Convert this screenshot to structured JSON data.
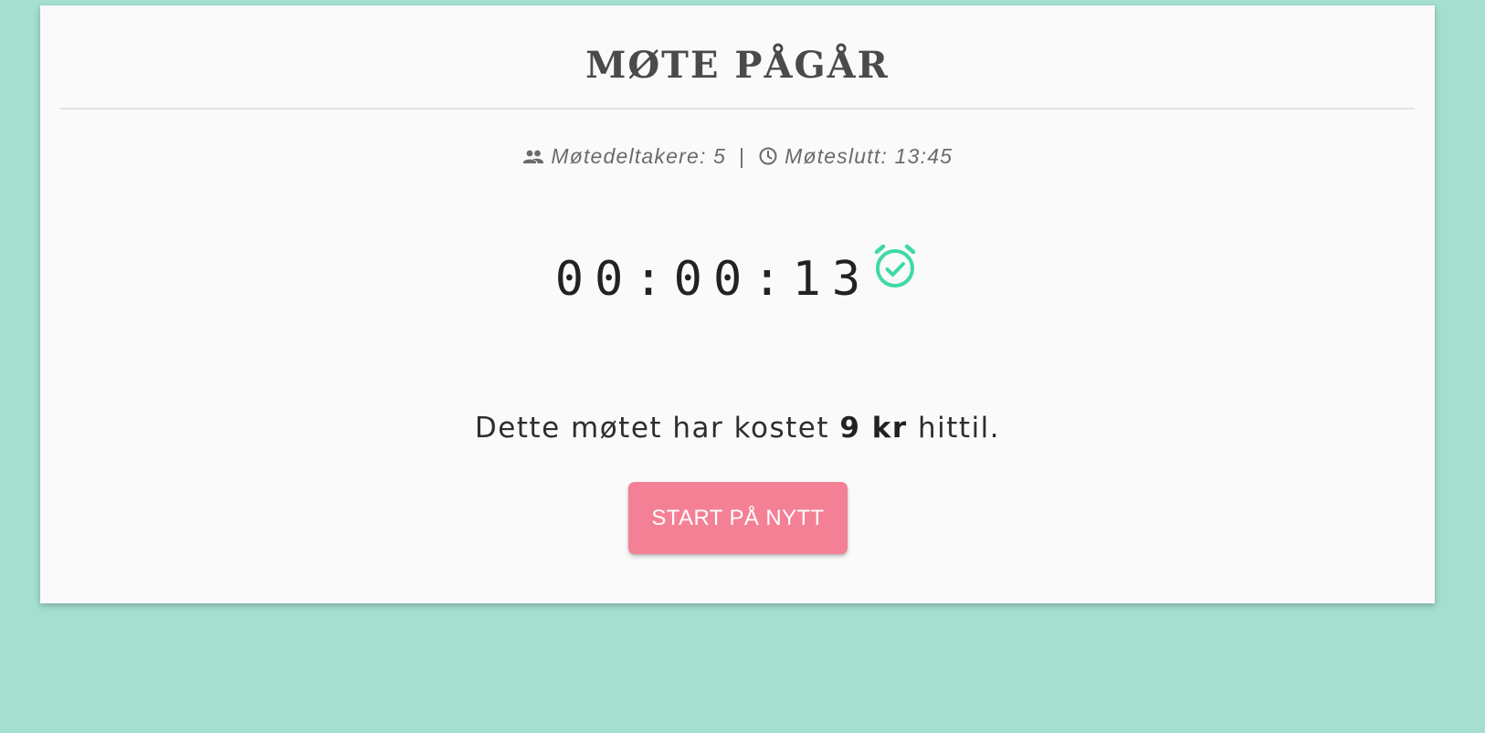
{
  "header": {
    "title": "MØTE PÅGÅR"
  },
  "meta": {
    "participants_label": "Møtedeltakere: 5",
    "separator": "|",
    "end_label": "Møteslutt: 13:45",
    "participants_icon": "people-icon",
    "end_icon": "clock-icon"
  },
  "timer": {
    "value": "00:00:13",
    "icon": "alarm-check-icon"
  },
  "cost": {
    "prefix": "Dette møtet har kostet ",
    "amount": "9 kr",
    "suffix": " hittil."
  },
  "actions": {
    "restart_label": "START PÅ NYTT"
  },
  "colors": {
    "background": "#a4dfcf",
    "card": "#fafafa",
    "accent": "#3fd9a8",
    "button": "#f48096"
  }
}
